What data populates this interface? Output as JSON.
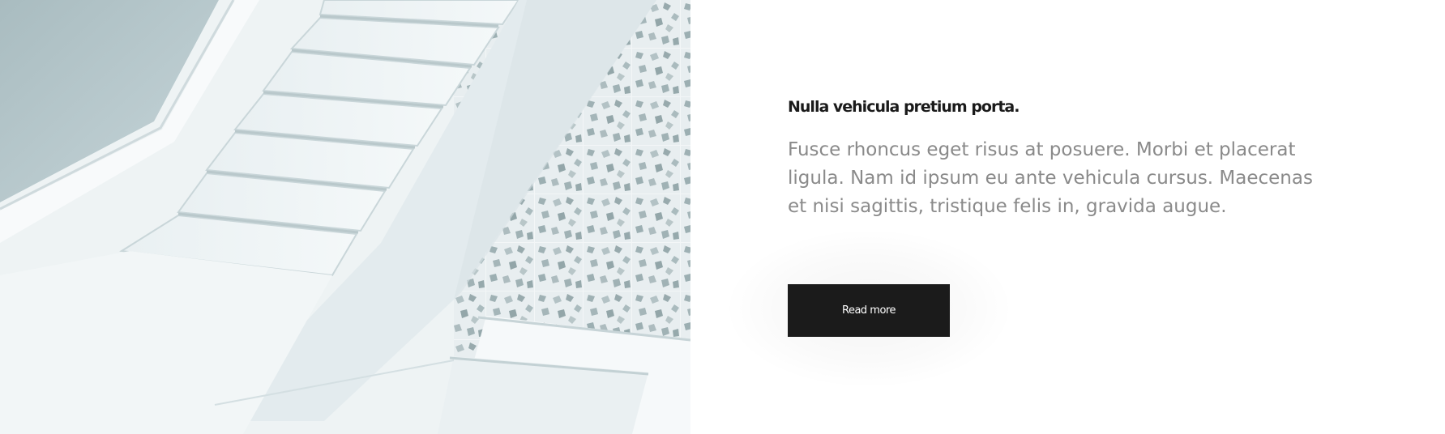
{
  "image": {
    "semantic": "white-staircase-photo",
    "accent": "#dfe9ec"
  },
  "content": {
    "heading": "Nulla vehicula pretium porta.",
    "body": "Fusce rhoncus eget risus at posuere. Morbi et placerat ligula. Nam id ipsum eu ante vehicula cursus. Maecenas et nisi sagittis, tristique felis in, gravida augue.",
    "button_label": "Read more"
  },
  "colors": {
    "heading": "#1a1a1a",
    "body": "#8a8a8a",
    "button_bg": "#1b1b1b",
    "button_text": "#ffffff"
  }
}
